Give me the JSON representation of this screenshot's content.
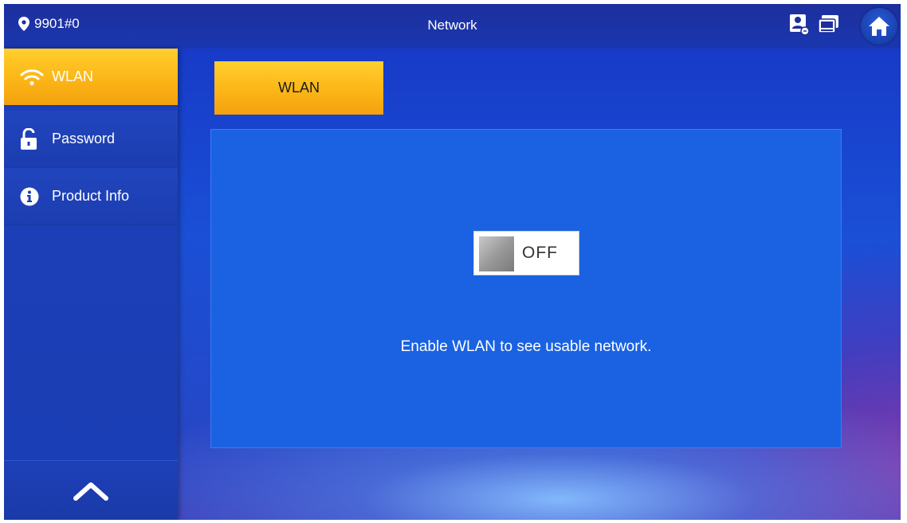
{
  "header": {
    "location": "9901#0",
    "title": "Network",
    "icons": [
      "location-pin-icon",
      "contact-card-icon",
      "monitor-icon",
      "home-icon"
    ]
  },
  "sidebar": {
    "items": [
      {
        "label": "WLAN",
        "icon": "wifi-icon",
        "active": true
      },
      {
        "label": "Password",
        "icon": "unlock-icon",
        "active": false
      },
      {
        "label": "Product Info",
        "icon": "info-icon",
        "active": false
      }
    ],
    "scroll_icon": "chevron-up-icon"
  },
  "main": {
    "tab_label": "WLAN",
    "toggle_state": "OFF",
    "hint": "Enable WLAN to see usable network."
  },
  "colors": {
    "accent": "#fbb315",
    "background": "#1a4fd6",
    "panel": "#1a62e2",
    "header": "#1d2f9c"
  }
}
